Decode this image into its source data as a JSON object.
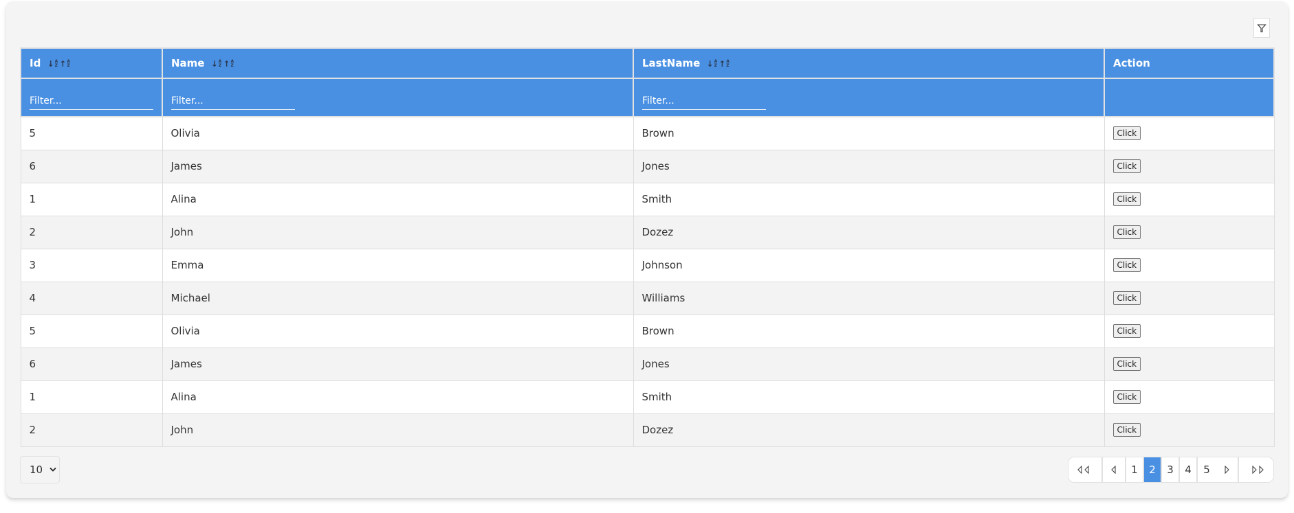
{
  "toolbar": {
    "filter_toggle_icon": "filter-funnel-icon"
  },
  "table": {
    "columns": [
      {
        "key": "id",
        "label": "Id",
        "sortable": true,
        "filterable": true
      },
      {
        "key": "name",
        "label": "Name",
        "sortable": true,
        "filterable": true
      },
      {
        "key": "lastname",
        "label": "LastName",
        "sortable": true,
        "filterable": true
      },
      {
        "key": "action",
        "label": "Action",
        "sortable": false,
        "filterable": false
      }
    ],
    "sort_icons": {
      "asc": "sort-alpha-down-icon",
      "desc": "sort-alpha-up-icon"
    },
    "filter_placeholder": "Filter...",
    "filters": {
      "id": "",
      "name": "",
      "lastname": ""
    },
    "action_button_label": "Click",
    "rows": [
      {
        "id": "5",
        "name": "Olivia",
        "lastname": "Brown"
      },
      {
        "id": "6",
        "name": "James",
        "lastname": "Jones"
      },
      {
        "id": "1",
        "name": "Alina",
        "lastname": "Smith"
      },
      {
        "id": "2",
        "name": "John",
        "lastname": "Dozez"
      },
      {
        "id": "3",
        "name": "Emma",
        "lastname": "Johnson"
      },
      {
        "id": "4",
        "name": "Michael",
        "lastname": "Williams"
      },
      {
        "id": "5",
        "name": "Olivia",
        "lastname": "Brown"
      },
      {
        "id": "6",
        "name": "James",
        "lastname": "Jones"
      },
      {
        "id": "1",
        "name": "Alina",
        "lastname": "Smith"
      },
      {
        "id": "2",
        "name": "John",
        "lastname": "Dozez"
      }
    ]
  },
  "footer": {
    "page_size": "10",
    "pagination": {
      "pages": [
        "1",
        "2",
        "3",
        "4",
        "5"
      ],
      "current_page": "2",
      "first_icon": "first-page-icon",
      "prev_icon": "prev-page-icon",
      "next_icon": "next-page-icon",
      "last_icon": "last-page-icon"
    }
  },
  "colors": {
    "header_bg": "#4a90e2",
    "card_bg": "#f4f4f4",
    "row_alt_bg": "#f3f3f3",
    "active_page_bg": "#4a90e2"
  }
}
